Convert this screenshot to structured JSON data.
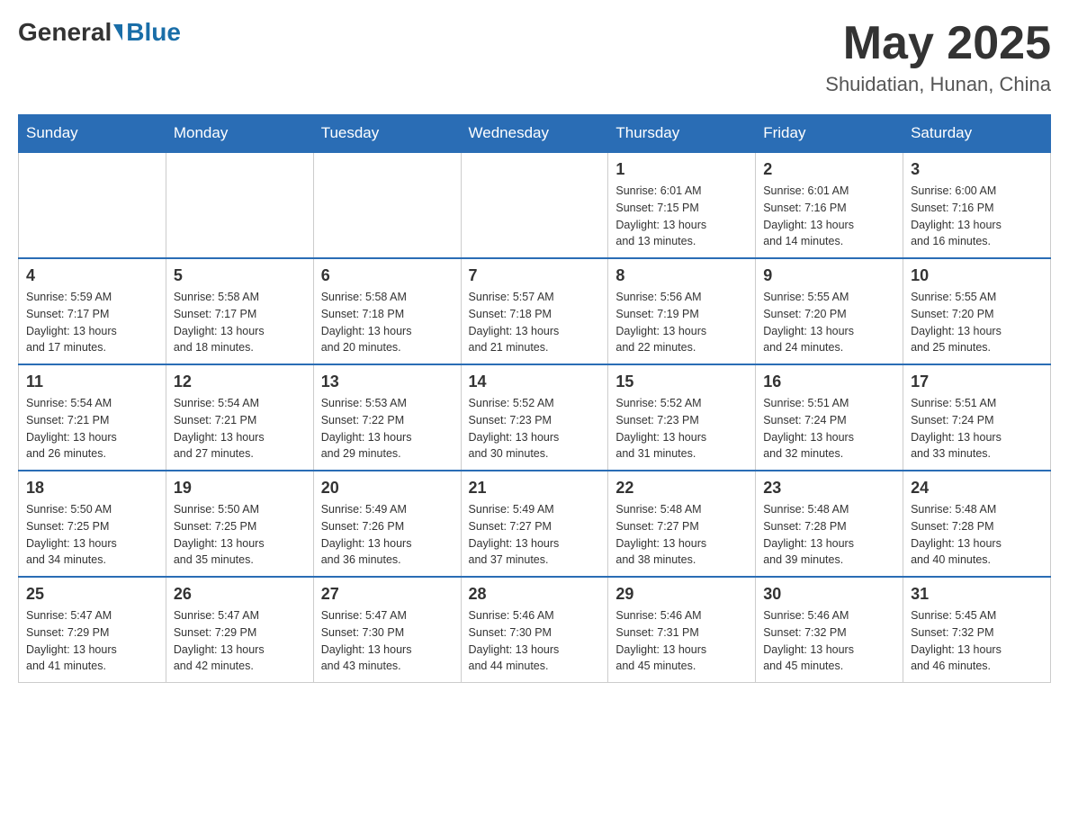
{
  "header": {
    "logo": {
      "general": "General",
      "blue": "Blue"
    },
    "title": "May 2025",
    "location": "Shuidatian, Hunan, China"
  },
  "days_of_week": [
    "Sunday",
    "Monday",
    "Tuesday",
    "Wednesday",
    "Thursday",
    "Friday",
    "Saturday"
  ],
  "weeks": [
    [
      {
        "day": "",
        "info": ""
      },
      {
        "day": "",
        "info": ""
      },
      {
        "day": "",
        "info": ""
      },
      {
        "day": "",
        "info": ""
      },
      {
        "day": "1",
        "info": "Sunrise: 6:01 AM\nSunset: 7:15 PM\nDaylight: 13 hours\nand 13 minutes."
      },
      {
        "day": "2",
        "info": "Sunrise: 6:01 AM\nSunset: 7:16 PM\nDaylight: 13 hours\nand 14 minutes."
      },
      {
        "day": "3",
        "info": "Sunrise: 6:00 AM\nSunset: 7:16 PM\nDaylight: 13 hours\nand 16 minutes."
      }
    ],
    [
      {
        "day": "4",
        "info": "Sunrise: 5:59 AM\nSunset: 7:17 PM\nDaylight: 13 hours\nand 17 minutes."
      },
      {
        "day": "5",
        "info": "Sunrise: 5:58 AM\nSunset: 7:17 PM\nDaylight: 13 hours\nand 18 minutes."
      },
      {
        "day": "6",
        "info": "Sunrise: 5:58 AM\nSunset: 7:18 PM\nDaylight: 13 hours\nand 20 minutes."
      },
      {
        "day": "7",
        "info": "Sunrise: 5:57 AM\nSunset: 7:18 PM\nDaylight: 13 hours\nand 21 minutes."
      },
      {
        "day": "8",
        "info": "Sunrise: 5:56 AM\nSunset: 7:19 PM\nDaylight: 13 hours\nand 22 minutes."
      },
      {
        "day": "9",
        "info": "Sunrise: 5:55 AM\nSunset: 7:20 PM\nDaylight: 13 hours\nand 24 minutes."
      },
      {
        "day": "10",
        "info": "Sunrise: 5:55 AM\nSunset: 7:20 PM\nDaylight: 13 hours\nand 25 minutes."
      }
    ],
    [
      {
        "day": "11",
        "info": "Sunrise: 5:54 AM\nSunset: 7:21 PM\nDaylight: 13 hours\nand 26 minutes."
      },
      {
        "day": "12",
        "info": "Sunrise: 5:54 AM\nSunset: 7:21 PM\nDaylight: 13 hours\nand 27 minutes."
      },
      {
        "day": "13",
        "info": "Sunrise: 5:53 AM\nSunset: 7:22 PM\nDaylight: 13 hours\nand 29 minutes."
      },
      {
        "day": "14",
        "info": "Sunrise: 5:52 AM\nSunset: 7:23 PM\nDaylight: 13 hours\nand 30 minutes."
      },
      {
        "day": "15",
        "info": "Sunrise: 5:52 AM\nSunset: 7:23 PM\nDaylight: 13 hours\nand 31 minutes."
      },
      {
        "day": "16",
        "info": "Sunrise: 5:51 AM\nSunset: 7:24 PM\nDaylight: 13 hours\nand 32 minutes."
      },
      {
        "day": "17",
        "info": "Sunrise: 5:51 AM\nSunset: 7:24 PM\nDaylight: 13 hours\nand 33 minutes."
      }
    ],
    [
      {
        "day": "18",
        "info": "Sunrise: 5:50 AM\nSunset: 7:25 PM\nDaylight: 13 hours\nand 34 minutes."
      },
      {
        "day": "19",
        "info": "Sunrise: 5:50 AM\nSunset: 7:25 PM\nDaylight: 13 hours\nand 35 minutes."
      },
      {
        "day": "20",
        "info": "Sunrise: 5:49 AM\nSunset: 7:26 PM\nDaylight: 13 hours\nand 36 minutes."
      },
      {
        "day": "21",
        "info": "Sunrise: 5:49 AM\nSunset: 7:27 PM\nDaylight: 13 hours\nand 37 minutes."
      },
      {
        "day": "22",
        "info": "Sunrise: 5:48 AM\nSunset: 7:27 PM\nDaylight: 13 hours\nand 38 minutes."
      },
      {
        "day": "23",
        "info": "Sunrise: 5:48 AM\nSunset: 7:28 PM\nDaylight: 13 hours\nand 39 minutes."
      },
      {
        "day": "24",
        "info": "Sunrise: 5:48 AM\nSunset: 7:28 PM\nDaylight: 13 hours\nand 40 minutes."
      }
    ],
    [
      {
        "day": "25",
        "info": "Sunrise: 5:47 AM\nSunset: 7:29 PM\nDaylight: 13 hours\nand 41 minutes."
      },
      {
        "day": "26",
        "info": "Sunrise: 5:47 AM\nSunset: 7:29 PM\nDaylight: 13 hours\nand 42 minutes."
      },
      {
        "day": "27",
        "info": "Sunrise: 5:47 AM\nSunset: 7:30 PM\nDaylight: 13 hours\nand 43 minutes."
      },
      {
        "day": "28",
        "info": "Sunrise: 5:46 AM\nSunset: 7:30 PM\nDaylight: 13 hours\nand 44 minutes."
      },
      {
        "day": "29",
        "info": "Sunrise: 5:46 AM\nSunset: 7:31 PM\nDaylight: 13 hours\nand 45 minutes."
      },
      {
        "day": "30",
        "info": "Sunrise: 5:46 AM\nSunset: 7:32 PM\nDaylight: 13 hours\nand 45 minutes."
      },
      {
        "day": "31",
        "info": "Sunrise: 5:45 AM\nSunset: 7:32 PM\nDaylight: 13 hours\nand 46 minutes."
      }
    ]
  ]
}
